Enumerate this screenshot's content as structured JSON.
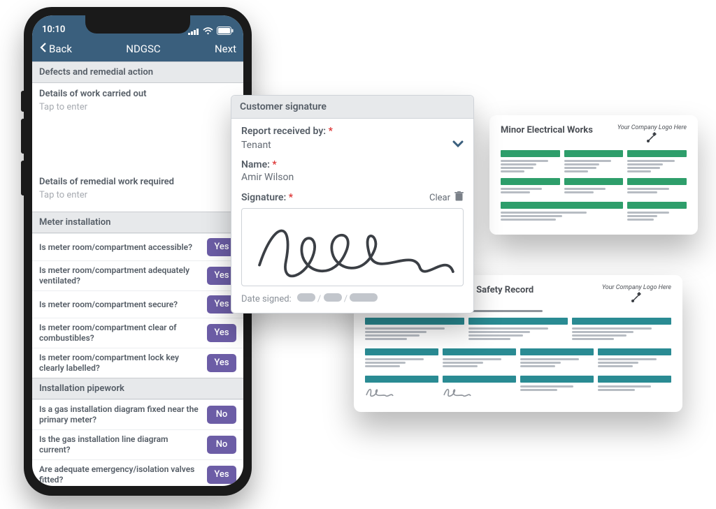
{
  "phone": {
    "status_time": "10:10",
    "nav": {
      "back": "Back",
      "title": "NDGSC",
      "next": "Next"
    },
    "sections": {
      "defects_header": "Defects and remedial action",
      "work_out_label": "Details of work carried out",
      "placeholder": "Tap to enter",
      "remedial_label": "Details of remedial work required",
      "meter_header": "Meter installation",
      "meter_q": [
        "Is meter room/compartment accessible?",
        "Is meter room/compartment adequately ventilated?",
        "Is meter room/compartment secure?",
        "Is meter room/compartment clear of combustibles?",
        "Is meter room/compartment lock key clearly labelled?"
      ],
      "meter_a": [
        "Yes",
        "Yes",
        "Yes",
        "Yes",
        "Yes"
      ],
      "pipe_header": "Installation pipework",
      "pipe_q": [
        "Is a gas installation diagram fixed near the primary meter?",
        "Is the gas installation line diagram current?",
        "Are adequate emergency/isolation valves fitted?"
      ],
      "pipe_a": [
        "No",
        "No",
        "Yes"
      ]
    }
  },
  "sig": {
    "header": "Customer signature",
    "received_label": "Report received by:",
    "received_value": "Tenant",
    "name_label": "Name:",
    "name_value": "Amir Wilson",
    "sign_label": "Signature:",
    "clear": "Clear",
    "date_label": "Date signed:"
  },
  "reports": {
    "r1_title": "Landlord Home Owner Gas Safety Record",
    "r2_title": "Minor Electrical Works",
    "logo_ph": "Your Company Logo Here"
  }
}
